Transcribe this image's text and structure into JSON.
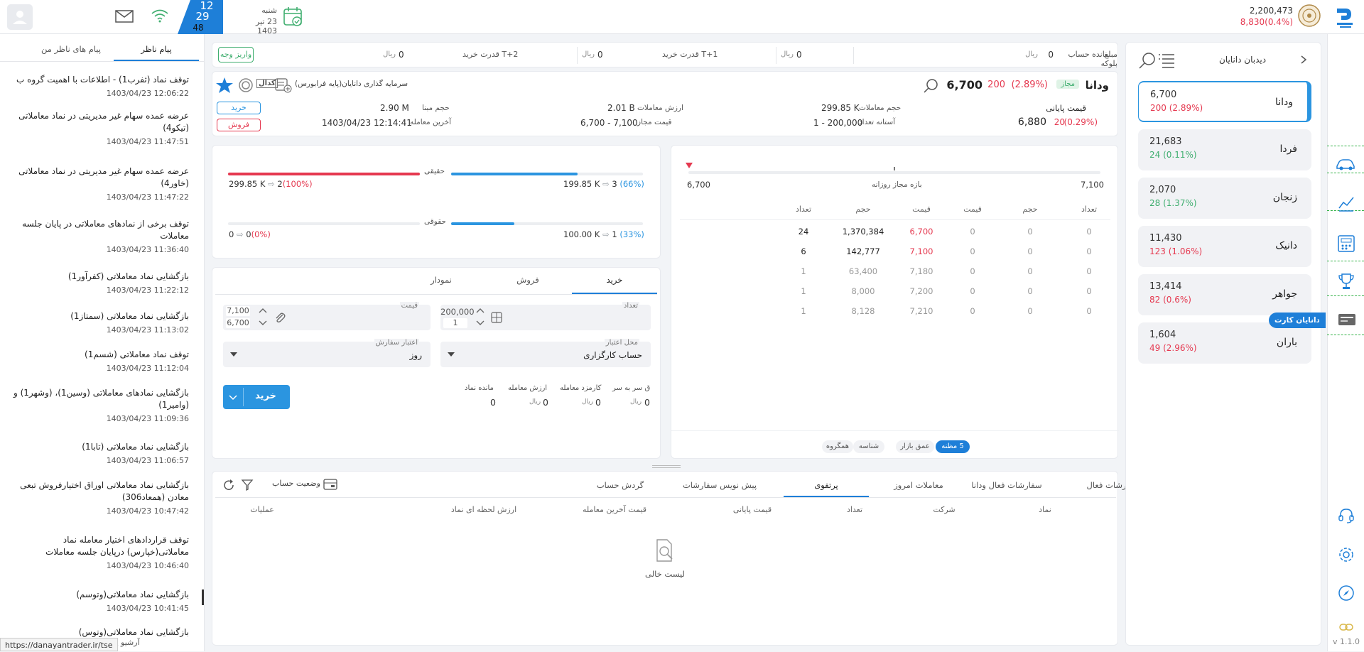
{
  "topbar": {
    "index_value": "2,200,473",
    "index_change": "8,830(0.4%)",
    "date_day": "شنبه",
    "date_text": "23 تیر 1403",
    "clock_h": "12",
    "clock_m": "29",
    "clock_s": "48"
  },
  "account": {
    "balance_label": "مانده حساب",
    "balance_value": "0",
    "balance_unit": "ریال",
    "block_label": "مبلغ بلوکه",
    "block_value": "0",
    "block_unit": "ریال",
    "t1_label": "قدرت خرید T+1",
    "t1_value": "0",
    "t1_unit": "ریال",
    "t2_label": "قدرت خرید T+2",
    "t2_value": "0",
    "t2_unit": "ریال",
    "deposit": "واریز وجه"
  },
  "symbol": {
    "name": "ودانا",
    "badge": "مجاز",
    "price": "6,700",
    "change": "200",
    "change_pct": "(2.89%)",
    "company": "سرمایه گذاری دانایان(پایه فرابورس)",
    "close_label": "قیمت پایانی",
    "close_price": "6,880",
    "close_change": "20",
    "close_pct": "(0.29%)",
    "vol_label": "حجم معاملات",
    "vol_value": "299.85 K",
    "val_label": "ارزش معاملات",
    "val_value": "2.01 B",
    "base_label": "حجم مبنا",
    "base_value": "2.90 M",
    "thr_label": "آستانه تعداد",
    "thr_value": "1 - 200,000",
    "allowed_label": "قیمت مجاز",
    "allowed_value": "6,700 - 7,100",
    "last_label": "آخرین معامله",
    "last_value": "1403/04/23 12:14:41",
    "buy": "خرید",
    "sell": "فروش"
  },
  "watchlist": {
    "title": "دیدبان دانایان",
    "items": [
      {
        "name": "ودانا",
        "price": "6,700",
        "change": "200 (2.89%)",
        "dir": "down"
      },
      {
        "name": "فردا",
        "price": "21,683",
        "change": "24 (0.11%)",
        "dir": "up"
      },
      {
        "name": "زنجان",
        "price": "2,070",
        "change": "28 (1.37%)",
        "dir": "up"
      },
      {
        "name": "دانیک",
        "price": "11,430",
        "change": "123 (1.06%)",
        "dir": "down"
      },
      {
        "name": "جواهر",
        "price": "13,414",
        "change": "82 (0.6%)",
        "dir": "down"
      },
      {
        "name": "باران",
        "price": "1,604",
        "change": "49 (2.96%)",
        "dir": "down"
      }
    ]
  },
  "orderbook": {
    "range_min": "6,700",
    "range_max": "7,100",
    "range_label": "بازه مجاز روزانه",
    "headers": [
      "تعداد",
      "حجم",
      "قیمت",
      "قیمت",
      "حجم",
      "تعداد"
    ],
    "rows": [
      [
        "0",
        "0",
        "0",
        "6,700",
        "1,370,384",
        "24"
      ],
      [
        "0",
        "0",
        "0",
        "7,100",
        "142,777",
        "6"
      ],
      [
        "0",
        "0",
        "0",
        "7,180",
        "63,400",
        "1"
      ],
      [
        "0",
        "0",
        "0",
        "7,200",
        "8,000",
        "1"
      ],
      [
        "0",
        "0",
        "0",
        "7,210",
        "8,128",
        "1"
      ]
    ],
    "tabs": [
      "5 مظنه",
      "عمق بازار",
      "شناسه",
      "همگروه"
    ]
  },
  "clients": {
    "real_label": "حقیقی",
    "legal_label": "حقوقی",
    "real_buy_vol": "199.85 K",
    "real_buy_cnt": "3",
    "real_buy_pct": "(66%)",
    "real_sell_vol": "299.85 K",
    "real_sell_cnt": "2",
    "real_sell_pct": "(100%)",
    "legal_buy_vol": "100.00 K",
    "legal_buy_cnt": "1",
    "legal_buy_pct": "(33%)",
    "legal_sell_vol": "0",
    "legal_sell_cnt": "0",
    "legal_sell_pct": "(0%)",
    "real_buy_frac": 0.66,
    "real_sell_frac": 1.0,
    "legal_buy_frac": 0.33,
    "legal_sell_frac": 0.0
  },
  "order": {
    "tabs": [
      "خرید",
      "فروش",
      "نمودار"
    ],
    "qty_label": "تعداد",
    "qty_value": "200,000",
    "qty_step": "1",
    "price_label": "قیمت",
    "price_max": "7,100",
    "price_min": "6,700",
    "credit_label": "محل اعتبار",
    "credit_value": "حساب کارگزاری",
    "validity_label": "اعتبار سفارش",
    "validity_value": "روز",
    "breakeven_label": "ق سر به سر",
    "breakeven_value": "0",
    "fee_label": "کارمزد معامله",
    "fee_value": "0",
    "value_label": "ارزش معامله",
    "value_value": "0",
    "remain_label": "مانده نماد",
    "remain_value": "0",
    "unit": "ریال",
    "submit": "خرید"
  },
  "bottom": {
    "tabs": [
      "سفارشات فعال",
      "سفارشات فعال ودانا",
      "معاملات امروز",
      "پرتفوی",
      "پیش نویس سفارشات",
      "گردش حساب"
    ],
    "status": "وضعیت حساب",
    "cols": [
      "نماد",
      "شرکت",
      "تعداد",
      "قیمت پایانی",
      "قیمت آخرین معامله",
      "ارزش لحظه ای نماد",
      "عملیات"
    ],
    "empty": "لیست خالی"
  },
  "messages": {
    "tabs": [
      "پیام ناظر",
      "پیام های ناظر من"
    ],
    "items": [
      {
        "text": "توقف نماد (ثفرب1) - اطلاعات با اهمیت گروه ب",
        "time": "1403/04/23 12:06:22"
      },
      {
        "text": "عرضه عمده سهام غیر مدیریتی در نماد معاملاتی (تیکو4)",
        "time": "1403/04/23 11:47:51"
      },
      {
        "text": "عرضه عمده سهام غیر مدیریتی در نماد معاملاتی (خاور4)",
        "time": "1403/04/23 11:47:22"
      },
      {
        "text": "توقف برخی از نمادهای معاملاتی در پایان جلسه معاملات",
        "time": "1403/04/23 11:36:40"
      },
      {
        "text": "بازگشایی نماد معاملاتی (کفرآور1)",
        "time": "1403/04/23 11:22:12"
      },
      {
        "text": "بازگشایی نماد معاملاتی (سمتاز1)",
        "time": "1403/04/23 11:13:02"
      },
      {
        "text": "توقف نماد معاملاتی (شسم1)",
        "time": "1403/04/23 11:12:04"
      },
      {
        "text": "بازگشایی نمادهای معاملاتی (وسین1)، (وشهر1) و (وامیر1)",
        "time": "1403/04/23 11:09:36"
      },
      {
        "text": "بازگشایی نماد معاملاتی (تابا1)",
        "time": "1403/04/23 11:06:57"
      },
      {
        "text": "بازگشایی نماد معاملاتی اوراق اختیارفروش تبعی معادن (همعاد306)",
        "time": "1403/04/23 10:47:42"
      },
      {
        "text": "توقف قراردادهای اختیار معامله نماد معاملاتی(خپارس) درپایان جلسه معاملات",
        "time": "1403/04/23 10:46:40"
      },
      {
        "text": "بازگشایی نماد معاملاتی(وتوسم)",
        "time": "1403/04/23 10:41:45"
      },
      {
        "text": "بازگشایی نماد معاملاتی(وتوس)",
        "time": ""
      }
    ],
    "archive": "آرشیو پیام"
  },
  "sidebar": {
    "card_label": "دانایان کارت",
    "version": "v 1.1.0"
  },
  "status_url": "https://danayantrader.ir/tse"
}
